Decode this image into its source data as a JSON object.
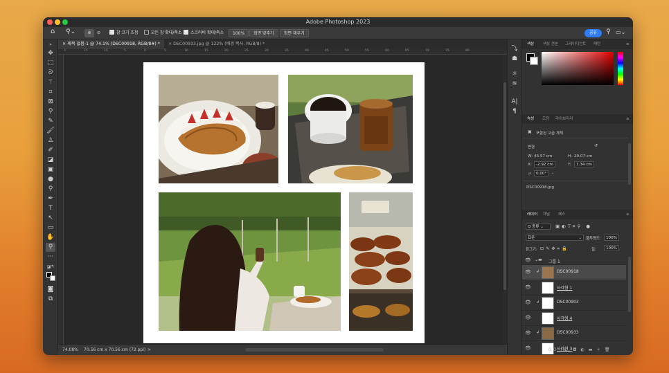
{
  "app_title": "Adobe Photoshop 2023",
  "options_bar": {
    "checkbox1": "창 크기 조정",
    "checkbox2": "모든 창 확대/축소",
    "checkbox3": "스크러비 확대/축소",
    "zoom_value": "100%",
    "fit_screen": "화면 맞추기",
    "fill_screen": "화면 채우기",
    "share": "공유"
  },
  "tabs": [
    {
      "label": "제목 없음-1 @ 74.1% (DSC00918, RGB/8#) *",
      "close": "×",
      "active": true
    },
    {
      "label": "DSC00933.jpg @ 122% (배경 복사, RGB/8) *",
      "close": "×",
      "active": false
    }
  ],
  "ruler_ticks": [
    "0",
    "15",
    "10",
    "5",
    "0",
    "5",
    "10",
    "15",
    "20",
    "25",
    "30",
    "35",
    "40",
    "45",
    "50",
    "55",
    "60",
    "65",
    "70",
    "75",
    "80"
  ],
  "status": {
    "zoom": "74.08%",
    "doc_size": "70.56 cm x 70.56 cm (72 ppi)",
    "arrow": ">"
  },
  "panels": {
    "color_tabs": [
      "색상",
      "색상 견본",
      "그레이디언트",
      "패턴"
    ],
    "props_tabs": [
      "속성",
      "조정",
      "라이브러리"
    ],
    "smart_object": "포함된 고급 개체",
    "transform_label": "변형",
    "w_label": "W:",
    "w_value": "43.57 cm",
    "h_label": "H:",
    "h_value": "29.07 cm",
    "x_label": "X:",
    "x_value": "-2.92 cm",
    "y_label": "Y:",
    "y_value": "1.34 cm",
    "angle_value": "0.00°",
    "file_name": "DSC00918.jpg",
    "layers_tabs": [
      "레이어",
      "채널",
      "패스"
    ],
    "kind_label": "Q 종류",
    "blend_mode": "표준",
    "opacity_label": "불투명도:",
    "opacity_value": "100%",
    "lock_label": "잠그기:",
    "fill_label": "칠:",
    "fill_value": "100%",
    "layers": [
      {
        "name": "그룹 1",
        "type": "group"
      },
      {
        "name": "DSC00918",
        "type": "clip",
        "selected": true
      },
      {
        "name": "사각형 1",
        "type": "shape"
      },
      {
        "name": "DSC00903",
        "type": "clip"
      },
      {
        "name": "사각형 4",
        "type": "shape"
      },
      {
        "name": "DSC00933",
        "type": "clip"
      },
      {
        "name": "사각형 3",
        "type": "shape"
      }
    ],
    "footer_icons": "GO fx. ◘ ◐ ▬ + 🗑"
  },
  "colors": {
    "accent": "#2d7cf6",
    "panel": "#323232",
    "selected_layer": "#4a4a4a"
  }
}
